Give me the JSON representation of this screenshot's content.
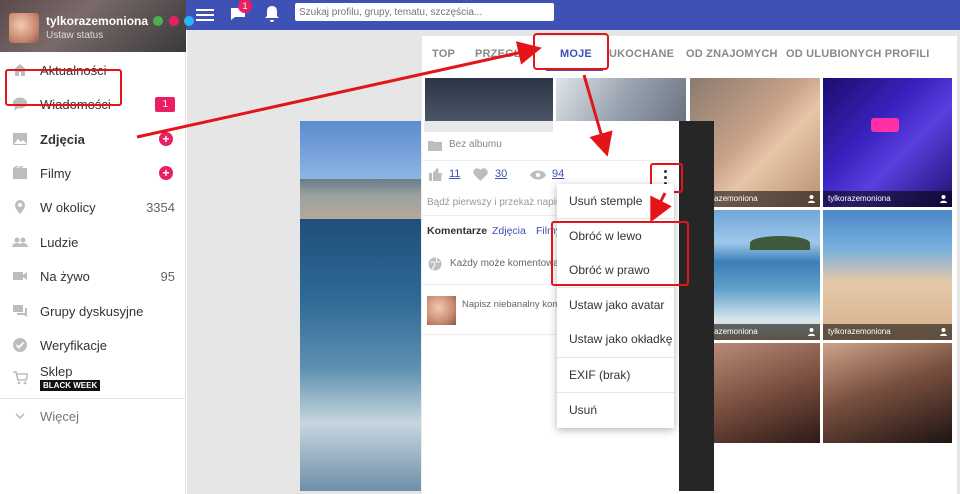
{
  "header": {
    "username": "tylkorazemoniona",
    "status": "Ustaw status",
    "chat_badge": "1",
    "search_placeholder": "Szukaj profilu, grupy, tematu, szczęścia..."
  },
  "sidebar": {
    "items": [
      {
        "label": "Aktualności",
        "icon": "home-icon"
      },
      {
        "label": "Wiadomości",
        "icon": "chat-bubble-icon",
        "badge": "1"
      },
      {
        "label": "Zdjęcia",
        "icon": "image-icon"
      },
      {
        "label": "Filmy",
        "icon": "film-icon"
      },
      {
        "label": "W okolicy",
        "icon": "location-pin-icon",
        "count": "3354"
      },
      {
        "label": "Ludzie",
        "icon": "people-icon"
      },
      {
        "label": "Na żywo",
        "icon": "video-camera-icon",
        "count": "95"
      },
      {
        "label": "Grupy dyskusyjne",
        "icon": "forum-icon"
      },
      {
        "label": "Weryfikacje",
        "icon": "check-circle-icon"
      },
      {
        "label": "Sklep",
        "icon": "cart-icon",
        "tag": "BLACK WEEK"
      },
      {
        "label": "Więcej",
        "icon": "chevron-down-icon"
      }
    ]
  },
  "tabs": [
    "TOP",
    "PRZEGL",
    "MOJE",
    "UKOCHANE",
    "OD ZNAJOMYCH",
    "OD ULUBIONYCH PROFILI"
  ],
  "active_tab": "MOJE",
  "grid_user": "tylkorazemoniona",
  "lightbox": {
    "album": "Bez albumu",
    "likes": "11",
    "hearts": "30",
    "views": "94",
    "first_comment_prompt": "Bądź pierwszy i przekaż napis",
    "tab_comments": "Komentarze",
    "tab_photos": "Zdjęcia",
    "tab_videos": "Filmy",
    "everyone_can_comment": "Każdy może komentowa",
    "write_comment": "Napisz niebanalny kom"
  },
  "dropdown": {
    "items": [
      "Usuń stemple",
      "Obróć w lewo",
      "Obróć w prawo",
      "Ustaw jako avatar",
      "Ustaw jako okładkę",
      "EXIF (brak)",
      "Usuń"
    ]
  },
  "colors": {
    "topbar": "#3f51b5",
    "accent_pink": "#e91e63",
    "annotation_red": "#e3151a"
  }
}
